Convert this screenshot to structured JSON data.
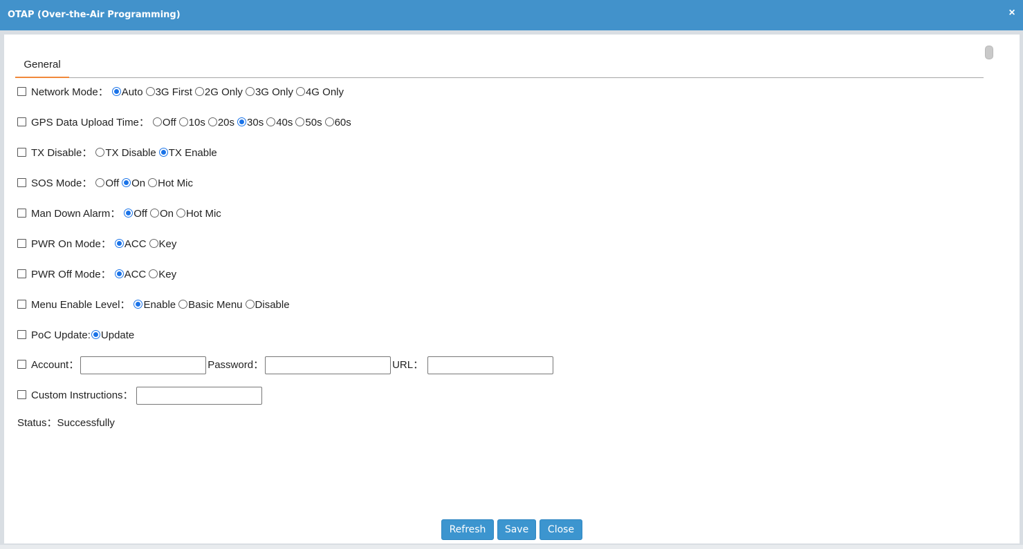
{
  "window": {
    "title": "OTAP (Over-the-Air Programming)",
    "close_glyph": "×"
  },
  "tabs": [
    {
      "label": "General",
      "active": true
    }
  ],
  "colors": {
    "titlebar": "#4292cb",
    "accent_tab": "#f0883a",
    "radio_selected": "#1a73e8",
    "button": "#3c95cf"
  },
  "rows": {
    "network_mode": {
      "label": "Network Mode：",
      "options": [
        "Auto",
        "3G First",
        "2G Only",
        "3G Only",
        "4G Only"
      ],
      "selected": "Auto"
    },
    "gps_upload": {
      "label": "GPS Data Upload Time：",
      "options": [
        "Off",
        "10s",
        "20s",
        "30s",
        "40s",
        "50s",
        "60s"
      ],
      "selected": "30s"
    },
    "tx_disable": {
      "label": "TX Disable：",
      "options": [
        "TX Disable",
        "TX Enable"
      ],
      "selected": "TX Enable"
    },
    "sos_mode": {
      "label": "SOS Mode：",
      "options": [
        "Off",
        "On",
        "Hot Mic"
      ],
      "selected": "On"
    },
    "man_down": {
      "label": "Man Down Alarm：",
      "options": [
        "Off",
        "On",
        "Hot Mic"
      ],
      "selected": "Off"
    },
    "pwr_on": {
      "label": "PWR On Mode：",
      "options": [
        "ACC",
        "Key"
      ],
      "selected": "ACC"
    },
    "pwr_off": {
      "label": "PWR Off Mode：",
      "options": [
        "ACC",
        "Key"
      ],
      "selected": "ACC"
    },
    "menu_level": {
      "label": "Menu Enable Level：",
      "options": [
        "Enable",
        "Basic Menu",
        "Disable"
      ],
      "selected": "Enable"
    },
    "poc_update": {
      "label": "PoC Update:",
      "options": [
        "Update"
      ],
      "selected": "Update"
    },
    "account": {
      "account_label": "Account：",
      "account_value": "",
      "password_label": "Password：",
      "password_value": "",
      "url_label": "URL：",
      "url_value": ""
    },
    "custom": {
      "label": "Custom Instructions：",
      "value": ""
    }
  },
  "status": {
    "text": "Status：Successfully"
  },
  "buttons": {
    "refresh": "Refresh",
    "save": "Save",
    "close": "Close"
  }
}
